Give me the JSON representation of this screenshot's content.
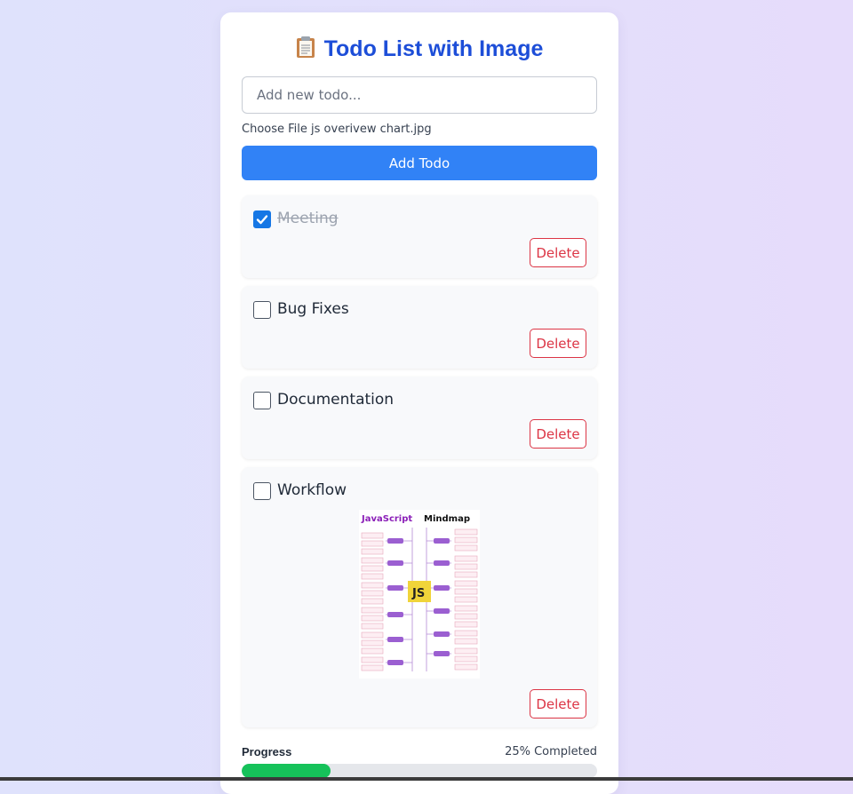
{
  "header": {
    "title": "Todo List with Image",
    "icon": "clipboard-icon"
  },
  "form": {
    "placeholder": "Add new todo...",
    "file_button_label": "Choose File",
    "file_name": "js overivew chart.jpg",
    "add_button_label": "Add Todo"
  },
  "todos": [
    {
      "text": "Meeting",
      "done": true,
      "delete_label": "Delete"
    },
    {
      "text": "Bug Fixes",
      "done": false,
      "delete_label": "Delete"
    },
    {
      "text": "Documentation",
      "done": false,
      "delete_label": "Delete"
    },
    {
      "text": "Workflow",
      "done": false,
      "delete_label": "Delete",
      "image": {
        "title_accent": "JavaScript",
        "title_rest": "Mindmap",
        "center_label": "JS"
      }
    }
  ],
  "progress": {
    "label": "Progress",
    "status_text": "25% Completed",
    "percent": 25
  },
  "colors": {
    "accent": "#3182f6",
    "title": "#1d4ed8",
    "danger": "#dc3545",
    "progress": "#16c25a",
    "checked": "#1677e5"
  }
}
